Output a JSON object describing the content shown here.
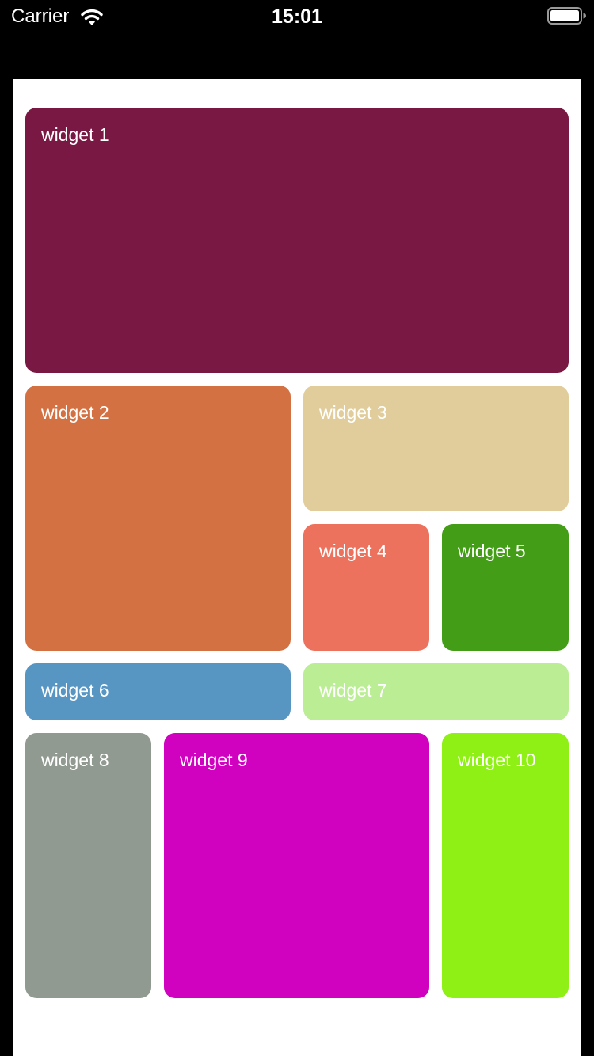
{
  "status_bar": {
    "carrier": "Carrier",
    "time": "15:01",
    "wifi_icon": "wifi-icon",
    "battery_icon": "battery-icon"
  },
  "widgets": [
    {
      "label": "widget 1",
      "color": "#791842"
    },
    {
      "label": "widget 2",
      "color": "#d47143"
    },
    {
      "label": "widget 3",
      "color": "#e1cd9b"
    },
    {
      "label": "widget 4",
      "color": "#ec725e"
    },
    {
      "label": "widget 5",
      "color": "#439d16"
    },
    {
      "label": "widget 6",
      "color": "#5795c3"
    },
    {
      "label": "widget 7",
      "color": "#bbed95"
    },
    {
      "label": "widget 8",
      "color": "#909a91"
    },
    {
      "label": "widget 9",
      "color": "#d002c0"
    },
    {
      "label": "widget 10",
      "color": "#8ef014"
    }
  ]
}
